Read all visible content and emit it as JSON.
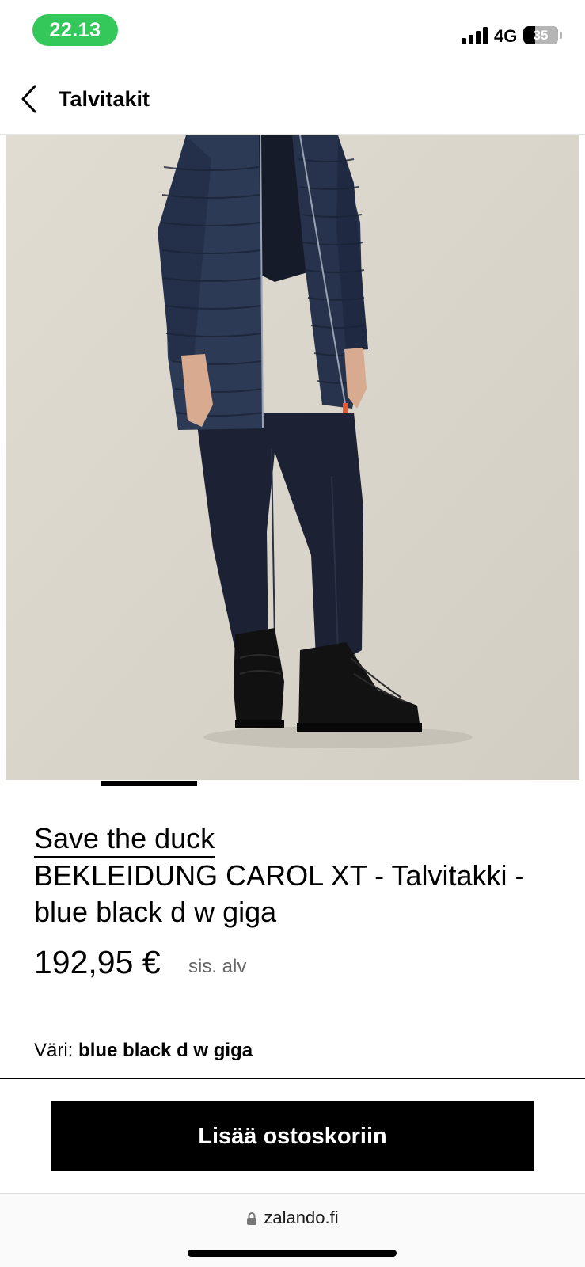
{
  "status_bar": {
    "time": "22.13",
    "network": "4G",
    "battery": "35",
    "battery_level": 0.35
  },
  "header": {
    "title": "Talvitakit"
  },
  "gallery": {
    "active_index": 1
  },
  "product": {
    "brand": "Save the duck",
    "name": "BEKLEIDUNG CAROL XT - Talvitakki - blue black d w giga",
    "price": "192,95 €",
    "price_note": "sis. alv",
    "color_label": "Väri:",
    "color_value": "blue black d w giga"
  },
  "actions": {
    "add_to_cart": "Lisää ostoskoriin"
  },
  "browser": {
    "url": "zalando.fi"
  },
  "colors": {
    "time_pill": "#34c759",
    "image_background": "#ddd9cf",
    "jacket": "#2c3a55",
    "trousers": "#1c2233",
    "button": "#000000"
  }
}
